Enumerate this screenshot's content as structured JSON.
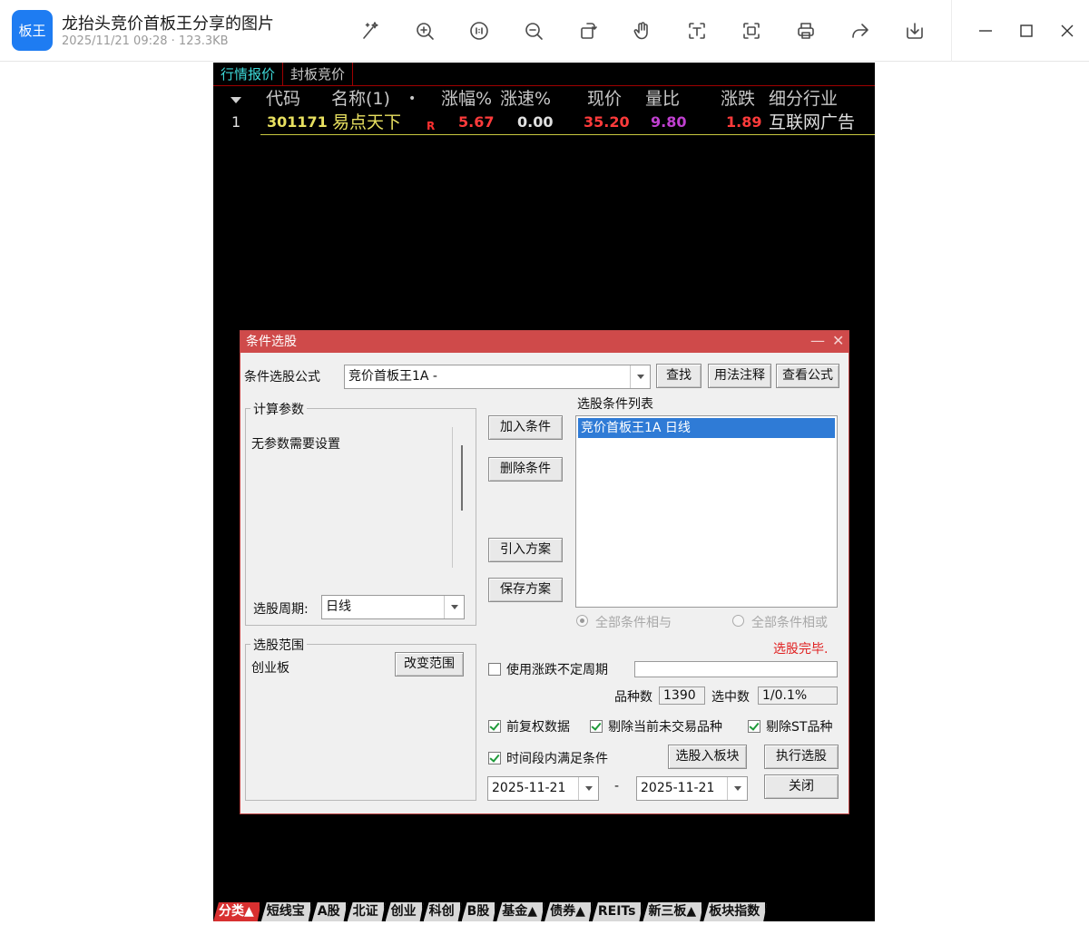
{
  "viewer": {
    "logo_text": "板王",
    "title": "龙抬头竞价首板王分享的图片",
    "meta": "2025/11/21 09:28 · 123.3KB",
    "toolbar_icons": [
      "magic-wand-icon",
      "zoom-in-icon",
      "actual-size-icon",
      "zoom-out-icon",
      "rotate-icon",
      "hand-icon",
      "text-recognize-icon",
      "scan-icon",
      "print-icon",
      "share-icon",
      "download-icon"
    ],
    "window_icons": [
      "minimize-icon",
      "maximize-icon",
      "close-icon"
    ]
  },
  "tabs": [
    {
      "label": "行情报价",
      "active": true
    },
    {
      "label": "封板竞价",
      "active": false
    }
  ],
  "quote": {
    "headers": {
      "code": "代码",
      "name": "名称(1)",
      "dot": "•",
      "pct": "涨幅%",
      "speed": "涨速%",
      "price": "现价",
      "ratio": "量比",
      "change": "涨跌",
      "industry": "细分行业"
    },
    "rows": [
      {
        "index": "1",
        "code": "301171",
        "name": "易点天下",
        "flag": "R",
        "pct": "5.67",
        "speed": "0.00",
        "price": "35.20",
        "ratio": "9.80",
        "change": "1.89",
        "industry": "互联网广告"
      }
    ],
    "colors": {
      "code": "#e8e060",
      "name": "#e8e060",
      "flag": "#ff3030",
      "pct": "#ff3b3b",
      "speed": "#e0e0e0",
      "price": "#ff3b3b",
      "ratio": "#c040d0",
      "change": "#ff3b3b",
      "industry": "#e0e0e0"
    }
  },
  "bottom_tabs": [
    {
      "label": "分类▲",
      "active": true
    },
    {
      "label": "短线宝",
      "active": false
    },
    {
      "label": "A股",
      "active": false
    },
    {
      "label": "北证",
      "active": false
    },
    {
      "label": "创业",
      "active": false
    },
    {
      "label": "科创",
      "active": false
    },
    {
      "label": "B股",
      "active": false
    },
    {
      "label": "基金▲",
      "active": false
    },
    {
      "label": "债券▲",
      "active": false
    },
    {
      "label": "REITs",
      "active": false
    },
    {
      "label": "新三板▲",
      "active": false
    },
    {
      "label": "板块指数",
      "active": false
    }
  ],
  "dialog": {
    "title": "条件选股",
    "min_icon": "—",
    "close_icon": "✕",
    "formula_label": "条件选股公式",
    "formula_value": "竞价首板王1A  -",
    "find_btn": "查找",
    "usage_btn": "用法注释",
    "view_formula_btn": "查看公式",
    "params_group": "计算参数",
    "params_text": "无参数需要设置",
    "period_label": "选股周期:",
    "period_value": "日线",
    "add_btn": "加入条件",
    "delete_btn": "删除条件",
    "import_btn": "引入方案",
    "save_btn": "保存方案",
    "cond_list_label": "选股条件列表",
    "cond_items": [
      "竞价首板王1A  日线"
    ],
    "radio_and": "全部条件相与",
    "radio_or": "全部条件相或",
    "status": "选股完毕.",
    "status_color": "#e02020",
    "range_group": "选股范围",
    "range_value": "创业板",
    "change_range_btn": "改变范围",
    "variable_period_label": "使用涨跌不定周期",
    "count_label": "品种数",
    "count_value": "1390",
    "selected_label": "选中数",
    "selected_value": "1/0.1%",
    "chk_adjust": "前复权数据",
    "chk_remove_untraded": "剔除当前未交易品种",
    "chk_remove_st": "剔除ST品种",
    "chk_time_range": "时间段内满足条件",
    "to_block_btn": "选股入板块",
    "execute_btn": "执行选股",
    "date_from": "2025-11-21",
    "date_sep": "-",
    "date_to": "2025-11-21",
    "close_btn": "关闭"
  }
}
